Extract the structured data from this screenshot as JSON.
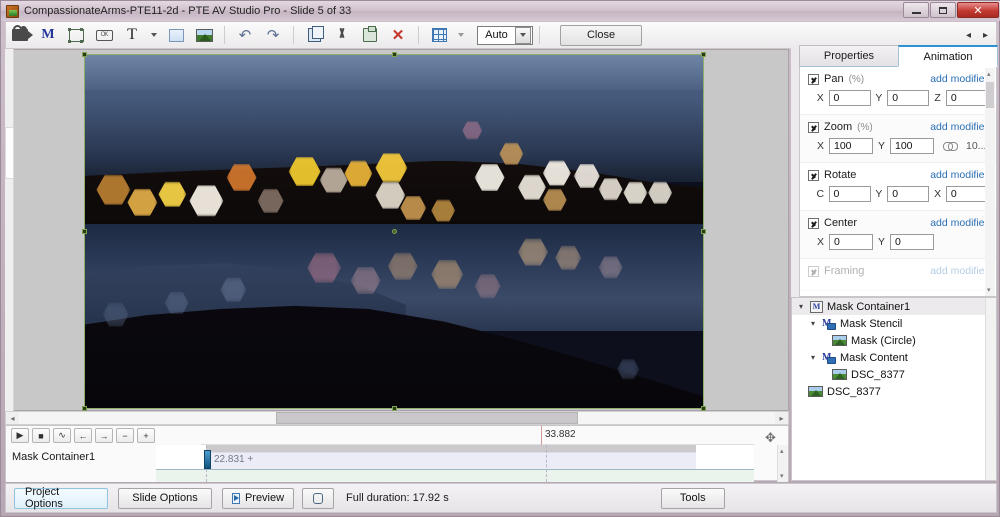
{
  "window": {
    "title": "CompassionateArms-PTE11-2d - PTE AV Studio Pro - Slide 5 of 33",
    "app_icon": "app-icon",
    "minimize": "–",
    "maximize": "□",
    "close": "✕"
  },
  "toolbar": {
    "items": [
      {
        "name": "video-object-icon",
        "glyph": "video-camera"
      },
      {
        "name": "mask-object-icon",
        "glyph": "M"
      },
      {
        "name": "frame-object-icon",
        "glyph": "frame"
      },
      {
        "name": "button-object-icon",
        "glyph": "button"
      },
      {
        "name": "text-object-icon",
        "glyph": "T"
      },
      {
        "name": "text-dropdown-icon",
        "glyph": "caret"
      },
      {
        "name": "rectangle-object-icon",
        "glyph": "rectangle"
      },
      {
        "name": "image-object-icon",
        "glyph": "image"
      },
      {
        "name": "undo-icon",
        "glyph": "undo"
      },
      {
        "name": "redo-icon",
        "glyph": "redo"
      },
      {
        "name": "copy-icon",
        "glyph": "copy"
      },
      {
        "name": "cut-icon",
        "glyph": "scissors"
      },
      {
        "name": "paste-icon",
        "glyph": "clipboard"
      },
      {
        "name": "delete-icon",
        "glyph": "X"
      },
      {
        "name": "grid-icon",
        "glyph": "grid"
      },
      {
        "name": "grid-dropdown-icon",
        "glyph": "caret"
      }
    ],
    "zoom_select_value": "Auto",
    "close_label": "Close",
    "prev_slide": "◂",
    "next_slide": "▸"
  },
  "canvas": {
    "selection_handles": 9,
    "image_name": "DSC_8377"
  },
  "panel": {
    "tabs": [
      {
        "label": "Properties",
        "active": false
      },
      {
        "label": "Animation",
        "active": true
      }
    ],
    "groups": [
      {
        "name": "pan",
        "label": "Pan",
        "unit": "(%)",
        "checked": true,
        "add_modifier": "add modifier",
        "fields": [
          {
            "label": "X",
            "value": "0"
          },
          {
            "label": "Y",
            "value": "0"
          },
          {
            "label": "Z",
            "value": "0"
          }
        ]
      },
      {
        "name": "zoom",
        "label": "Zoom",
        "unit": "(%)",
        "checked": true,
        "add_modifier": "add modifier",
        "fields": [
          {
            "label": "X",
            "value": "100"
          },
          {
            "label": "Y",
            "value": "100"
          }
        ],
        "link_icon": "link-icon",
        "link_value": "10..."
      },
      {
        "name": "rotate",
        "label": "Rotate",
        "unit": "",
        "checked": true,
        "add_modifier": "add modifier",
        "fields": [
          {
            "label": "C",
            "value": "0"
          },
          {
            "label": "Y",
            "value": "0"
          },
          {
            "label": "X",
            "value": "0"
          }
        ]
      },
      {
        "name": "center",
        "label": "Center",
        "unit": "",
        "checked": true,
        "add_modifier": "add modifier",
        "fields": [
          {
            "label": "X",
            "value": "0"
          },
          {
            "label": "Y",
            "value": "0"
          }
        ]
      },
      {
        "name": "framing",
        "label": "Framing",
        "unit": "",
        "checked": false,
        "add_modifier": "add modifier",
        "fields": []
      }
    ]
  },
  "tree": {
    "nodes": [
      {
        "label": "Mask Container1",
        "icon": "mask-container-icon",
        "indent": 0,
        "expanded": true,
        "selected": true
      },
      {
        "label": "Mask Stencil",
        "icon": "mask-stencil-icon",
        "indent": 1,
        "expanded": true,
        "selected": false
      },
      {
        "label": "Mask (Circle)",
        "icon": "image-thumb-icon",
        "indent": 2,
        "expanded": null,
        "selected": false
      },
      {
        "label": "Mask Content",
        "icon": "mask-content-icon",
        "indent": 1,
        "expanded": true,
        "selected": false
      },
      {
        "label": "DSC_8377",
        "icon": "image-thumb-icon",
        "indent": 2,
        "expanded": null,
        "selected": false
      },
      {
        "label": "DSC_8377",
        "icon": "image-thumb-icon",
        "indent": 1,
        "expanded": null,
        "selected": false
      }
    ]
  },
  "timeline": {
    "buttons": [
      {
        "name": "play-button",
        "glyph": "▶"
      },
      {
        "name": "stop-button",
        "glyph": "■"
      },
      {
        "name": "curve-button",
        "glyph": "∿"
      },
      {
        "name": "prev-keyframe-button",
        "glyph": "←"
      },
      {
        "name": "next-keyframe-button",
        "glyph": "→"
      },
      {
        "name": "remove-keyframe-button",
        "glyph": "−"
      },
      {
        "name": "add-keyframe-button",
        "glyph": "+"
      }
    ],
    "ruler_label": "33.882",
    "track_label": "Mask Container1",
    "keyframe_label": "22.831 +",
    "resize_handle": "✥"
  },
  "statusbar": {
    "project_options": "Project Options",
    "slide_options": "Slide Options",
    "preview": "Preview",
    "loop_icon": "loop-icon",
    "duration": "Full duration: 17.92 s",
    "tools": "Tools"
  }
}
